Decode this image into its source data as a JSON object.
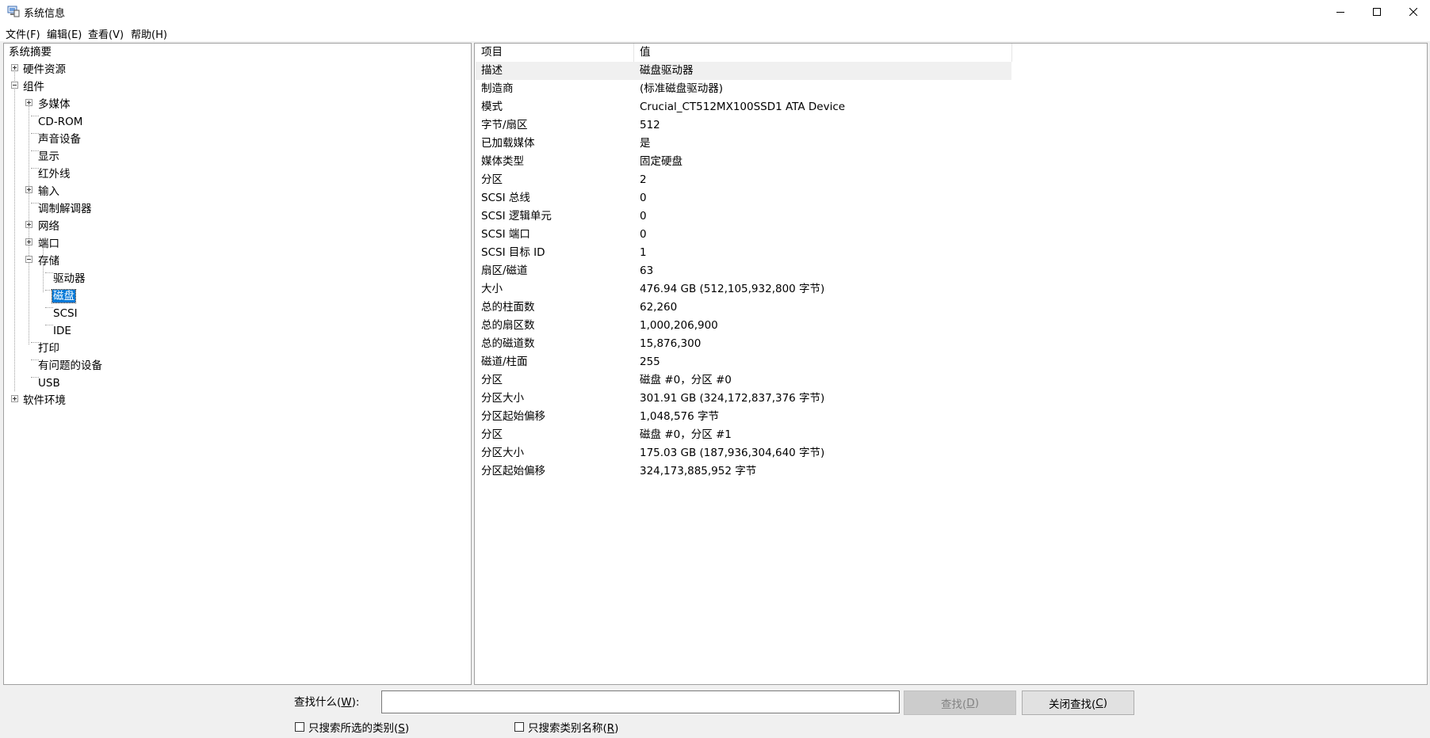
{
  "window": {
    "title": "系统信息",
    "icon": "system-info-icon"
  },
  "menu": [
    {
      "label": "文件(F)"
    },
    {
      "label": "编辑(E)"
    },
    {
      "label": "查看(V)"
    },
    {
      "label": "帮助(H)"
    }
  ],
  "tree": {
    "root": "系统摘要",
    "hardware": "硬件资源",
    "components": "组件",
    "multimedia": "多媒体",
    "cdrom": "CD-ROM",
    "sound": "声音设备",
    "display": "显示",
    "infrared": "红外线",
    "input": "输入",
    "modem": "调制解调器",
    "network": "网络",
    "ports": "端口",
    "storage": "存储",
    "drives": "驱动器",
    "disks": "磁盘",
    "scsi": "SCSI",
    "ide": "IDE",
    "printing": "打印",
    "problem_devices": "有问题的设备",
    "usb": "USB",
    "software": "软件环境"
  },
  "details": {
    "columns": {
      "item": "项目",
      "value": "值"
    },
    "rows": [
      {
        "k": "描述",
        "v": "磁盘驱动器"
      },
      {
        "k": "制造商",
        "v": "(标准磁盘驱动器)"
      },
      {
        "k": "模式",
        "v": "Crucial_CT512MX100SSD1 ATA Device"
      },
      {
        "k": "字节/扇区",
        "v": "512"
      },
      {
        "k": "已加载媒体",
        "v": "是"
      },
      {
        "k": "媒体类型",
        "v": "固定硬盘"
      },
      {
        "k": "分区",
        "v": "2"
      },
      {
        "k": "SCSI 总线",
        "v": "0"
      },
      {
        "k": "SCSI 逻辑单元",
        "v": "0"
      },
      {
        "k": "SCSI 端口",
        "v": "0"
      },
      {
        "k": "SCSI 目标 ID",
        "v": "1"
      },
      {
        "k": "扇区/磁道",
        "v": "63"
      },
      {
        "k": "大小",
        "v": "476.94 GB (512,105,932,800 字节)"
      },
      {
        "k": "总的柱面数",
        "v": "62,260"
      },
      {
        "k": "总的扇区数",
        "v": "1,000,206,900"
      },
      {
        "k": "总的磁道数",
        "v": "15,876,300"
      },
      {
        "k": "磁道/柱面",
        "v": "255"
      },
      {
        "k": "分区",
        "v": "磁盘 #0，分区 #0"
      },
      {
        "k": "分区大小",
        "v": "301.91 GB (324,172,837,376 字节)"
      },
      {
        "k": "分区起始偏移",
        "v": "1,048,576 字节"
      },
      {
        "k": "分区",
        "v": "磁盘 #0，分区 #1"
      },
      {
        "k": "分区大小",
        "v": "175.03 GB (187,936,304,640 字节)"
      },
      {
        "k": "分区起始偏移",
        "v": "324,173,885,952 字节"
      }
    ]
  },
  "find": {
    "label_pre": "查找什么(",
    "label_key": "W",
    "label_post": "):",
    "input_value": "",
    "find_pre": "查找(",
    "find_key": "D",
    "find_post": ")",
    "close_pre": "关闭查找(",
    "close_key": "C",
    "close_post": ")",
    "chk1_pre": "只搜索所选的类别(",
    "chk1_key": "S",
    "chk1_post": ")",
    "chk2_pre": "只搜索类别名称(",
    "chk2_key": "R",
    "chk2_post": ")"
  }
}
